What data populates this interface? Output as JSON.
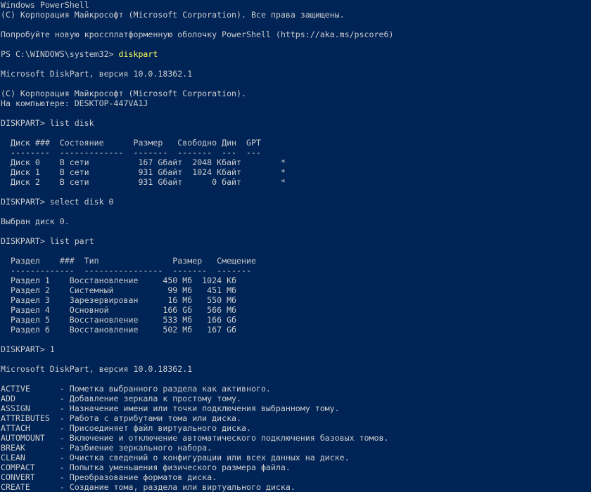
{
  "window": {
    "app": "Windows PowerShell"
  },
  "terminal": {
    "lines": [
      {
        "text": "Windows PowerShell"
      },
      {
        "text": "(C) Корпорация Майкрософт (Microsoft Corporation). Все права защищены."
      },
      {
        "text": ""
      },
      {
        "text": "Попробуйте новую кроссплатформенную оболочку PowerShell (https://aka.ms/pscore6)"
      },
      {
        "text": ""
      },
      {
        "text": "PS C:\\WINDOWS\\system32> ",
        "cmd": "diskpart"
      },
      {
        "text": ""
      },
      {
        "text": "Microsoft DiskPart, версия 10.0.18362.1"
      },
      {
        "text": ""
      },
      {
        "text": "(C) Корпорация Майкрософт (Microsoft Corporation)."
      },
      {
        "text": "На компьютере: DESKTOP-447VA1J"
      },
      {
        "text": ""
      },
      {
        "text": "DISKPART> list disk"
      },
      {
        "text": ""
      },
      {
        "text": "  Диск ###  Состояние      Размер   Свободно Дин  GPT"
      },
      {
        "text": "  --------  -------------  -------  -------  ---  ---"
      },
      {
        "text": "  Диск 0    В сети          167 Gбайт  2048 Кбайт        *"
      },
      {
        "text": "  Диск 1    В сети          931 Gбайт  1024 Кбайт        *"
      },
      {
        "text": "  Диск 2    В сети          931 Gбайт      0 байт        *"
      },
      {
        "text": ""
      },
      {
        "text": "DISKPART> select disk 0"
      },
      {
        "text": ""
      },
      {
        "text": "Выбран диск 0."
      },
      {
        "text": ""
      },
      {
        "text": "DISKPART> list part"
      },
      {
        "text": ""
      },
      {
        "text": "  Раздел    ###  Тип               Размер   Смещение"
      },
      {
        "text": "  -------------  ----------------  -------  -------"
      },
      {
        "text": "  Раздел 1    Восстановление     450 Мб  1024 Кб"
      },
      {
        "text": "  Раздел 2    Системный           99 Мб   451 Мб"
      },
      {
        "text": "  Раздел 3    Зарезервирован      16 Мб   550 Мб"
      },
      {
        "text": "  Раздел 4    Основной           166 Gб   566 Мб"
      },
      {
        "text": "  Раздел 5    Восстановление     533 Мб   166 Gб"
      },
      {
        "text": "  Раздел 6    Восстановление     502 Мб   167 Gб"
      },
      {
        "text": ""
      },
      {
        "text": "DISKPART> 1"
      },
      {
        "text": ""
      },
      {
        "text": "Microsoft DiskPart, версия 10.0.18362.1"
      },
      {
        "text": ""
      },
      {
        "text": "ACTIVE      - Пометка выбранного раздела как активного."
      },
      {
        "text": "ADD         - Добавление зеркала к простому тому."
      },
      {
        "text": "ASSIGN      - Назначение имени или точки подключения выбранному тому."
      },
      {
        "text": "ATTRIBUTES  - Работа с атрибутами тома или диска."
      },
      {
        "text": "ATTACH      - Присоединяет файл виртуального диска."
      },
      {
        "text": "AUTOMOUNT   - Включение и отключение автоматического подключения базовых томов."
      },
      {
        "text": "BREAK       - Разбиение зеркального набора."
      },
      {
        "text": "CLEAN       - Очистка сведений о конфигурации или всех данных на диске."
      },
      {
        "text": "COMPACT     - Попытка уменьшения физического размера файла."
      },
      {
        "text": "CONVERT     - Преобразование форматов диска."
      },
      {
        "text": "CREATE      - Создание тома, раздела или виртуального диска."
      }
    ]
  },
  "colors": {
    "background": "#012456",
    "text": "#cccccc",
    "command": "#ffff55"
  }
}
